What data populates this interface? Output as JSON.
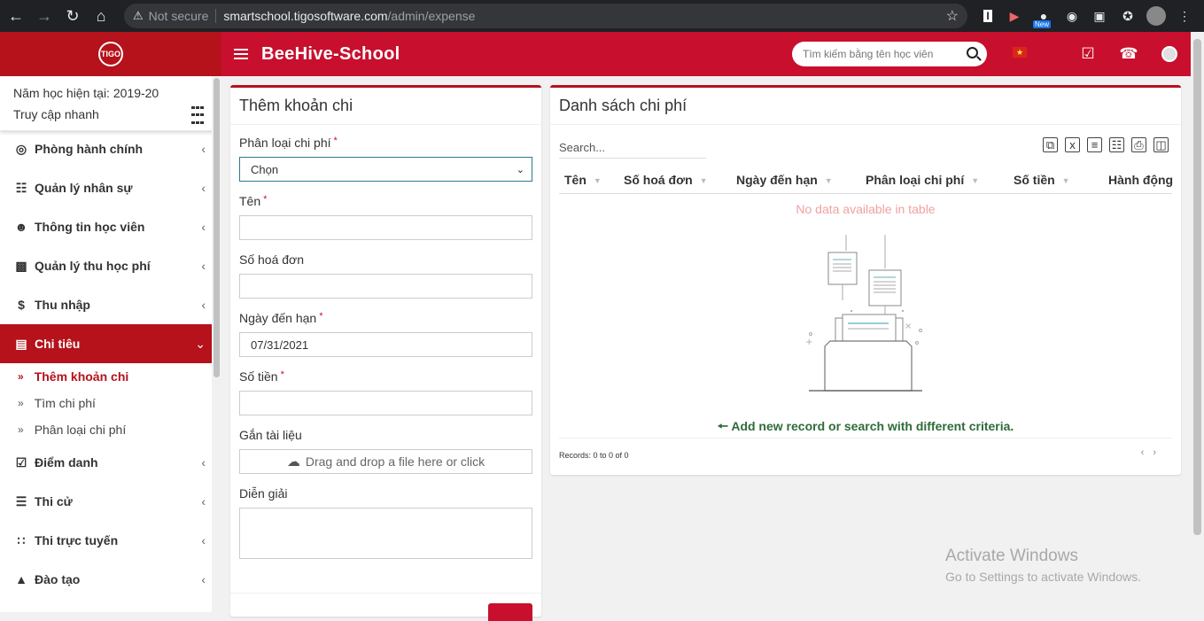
{
  "browser": {
    "security_label": "Not secure",
    "url_host": "smartschool.tigosoftware.com",
    "url_path": "/admin/expense",
    "new_badge": "New"
  },
  "header": {
    "logo_text": "TIGO",
    "brand": "BeeHive-School",
    "search_placeholder": "Tìm kiếm bằng tên học viên"
  },
  "sidebar": {
    "school_year": "Năm học hiện tại: 2019-20",
    "quick_access": "Truy cập nhanh",
    "items": [
      {
        "label": "Phòng hành chính",
        "icon": "globe-icon"
      },
      {
        "label": "Quản lý nhân sự",
        "icon": "sitemap-icon"
      },
      {
        "label": "Thông tin học viên",
        "icon": "user-plus-icon"
      },
      {
        "label": "Quản lý thu học phí",
        "icon": "money-icon"
      },
      {
        "label": "Thu nhập",
        "icon": "dollar-icon"
      },
      {
        "label": "Chi tiêu",
        "icon": "credit-card-icon"
      },
      {
        "label": "Điểm danh",
        "icon": "calendar-check-icon"
      },
      {
        "label": "Thi cử",
        "icon": "map-icon"
      },
      {
        "label": "Thi trực tuyến",
        "icon": "rss-icon"
      },
      {
        "label": "Đào tạo",
        "icon": "graduation-cap-icon"
      }
    ],
    "sub_items": [
      {
        "label": "Thêm khoản chi"
      },
      {
        "label": "Tìm chi phí"
      },
      {
        "label": "Phân loại chi phí"
      }
    ]
  },
  "form": {
    "title": "Thêm khoản chi",
    "category_label": "Phân loại chi phí",
    "category_value": "Chọn",
    "name_label": "Tên",
    "invoice_label": "Số hoá đơn",
    "due_date_label": "Ngày đến hạn",
    "due_date_value": "07/31/2021",
    "amount_label": "Số tiền",
    "attach_label": "Gắn tài liệu",
    "attach_hint": "Drag and drop a file here or click",
    "description_label": "Diễn giải",
    "required_mark": "*"
  },
  "list": {
    "title": "Danh sách chi phí",
    "search_placeholder": "Search...",
    "columns": [
      "Tên",
      "Số hoá đơn",
      "Ngày đến hạn",
      "Phân loại chi phí",
      "Số tiền",
      "Hành động"
    ],
    "empty_message": "No data available in table",
    "add_record_hint": "Add new record or search with different criteria.",
    "records_info": "Records: 0 to 0 of 0"
  },
  "watermark": {
    "line1": "Activate Windows",
    "line2": "Go to Settings to activate Windows."
  },
  "colors": {
    "primary": "#c8102e",
    "sidebar_active": "#b5121b",
    "success_text": "#2e6b3a"
  }
}
